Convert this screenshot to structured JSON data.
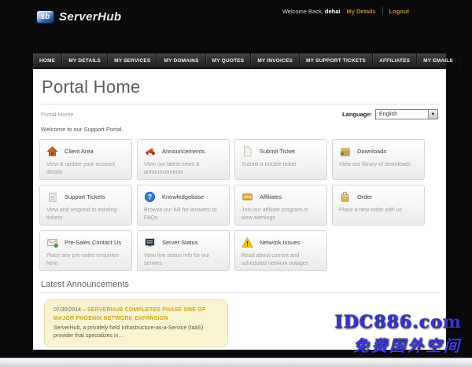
{
  "topbar": {
    "logo_badge": "sb",
    "logo_text": "ServerHub",
    "welcome_prefix": "Welcome Back,",
    "username": "dehai",
    "links": [
      {
        "label": "My Details"
      },
      {
        "label": "Logout"
      }
    ]
  },
  "nav": {
    "items": [
      "HOME",
      "MY DETAILS",
      "MY SERVICES",
      "MY DOMAINS",
      "MY QUOTES",
      "MY INVOICES",
      "MY SUPPORT TICKETS",
      "AFFILIATES",
      "MY EMAILS"
    ]
  },
  "page": {
    "title": "Portal Home",
    "breadcrumb": "Portal Home",
    "language_label": "Language:",
    "language_value": "English",
    "welcome_text": "Welcome to our Support Portal."
  },
  "shortcuts": [
    {
      "title": "Client Area",
      "desc": "View & update your account details",
      "icon": "home-icon"
    },
    {
      "title": "Announcements",
      "desc": "View our latest news & announcements",
      "icon": "megaphone-icon"
    },
    {
      "title": "Submit Ticket",
      "desc": "Submit a trouble ticket",
      "icon": "page-icon"
    },
    {
      "title": "Downloads",
      "desc": "View our library of downloads",
      "icon": "download-box-icon"
    },
    {
      "title": "Support Tickets",
      "desc": "View and respond to existing tickets",
      "icon": "notepad-icon"
    },
    {
      "title": "Knowledgebase",
      "desc": "Browse our KB for answers to FAQs",
      "icon": "question-icon"
    },
    {
      "title": "Affiliates",
      "desc": "Join our affiliate program or view earnings",
      "icon": "card-icon"
    },
    {
      "title": "Order",
      "desc": "Place a new order with us",
      "icon": "shopping-bag-icon"
    },
    {
      "title": "Pre-Sales Contact Us",
      "desc": "Place any pre-sales enquiries here",
      "icon": "envelope-icon"
    },
    {
      "title": "Server Status",
      "desc": "View live status info for our servers",
      "icon": "server-icon"
    },
    {
      "title": "Network Issues",
      "desc": "Read about current and scheduled network outages",
      "icon": "warning-icon"
    }
  ],
  "announcements": {
    "heading": "Latest Announcements",
    "items": [
      {
        "date": "07/30/2014",
        "separator": "–",
        "title": "SERVERHUB COMPLETES PHASE ONE OF MAJOR PHOENIX NETWORK EXPANSION",
        "excerpt": "ServerHub, a privately held Infrastructure-as-a-Service (IaaS) provider that specializes in..."
      }
    ]
  },
  "watermark": {
    "line1": "IDC886.com",
    "line2": "免费国外空间"
  },
  "colors": {
    "accent_gold": "#bb8e2e",
    "announcement_link_gold": "#d0a41f",
    "announcement_bg": "#faf3cf",
    "watermark_blue": "#3434d6",
    "nav_dark": "#1a1a1a"
  }
}
